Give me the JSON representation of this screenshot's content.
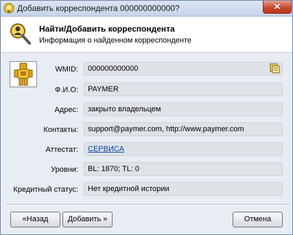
{
  "window": {
    "title": "Добавить корреспондента 000000000000?",
    "close_label": "✕",
    "title_icon": "webmoney-keeper-icon"
  },
  "header": {
    "title": "Найти/Добавить корреспондента",
    "subtitle": "Информация о найденном корреспонденте",
    "icon": "magnifier-person-icon"
  },
  "correspondent": {
    "avatar_icon": "robot-avatar-icon",
    "fields": {
      "wmid_label": "WMID:",
      "wmid_value": "000000000000",
      "fio_label": "Ф.И.О:",
      "fio_value": "PAYMER",
      "address_label": "Адрес:",
      "address_value": "закрыто владельцем",
      "contacts_label": "Контакты:",
      "contacts_value": "support@paymer.com, http://www.paymer.com",
      "attestat_label": "Аттестат:",
      "attestat_value": "СЕРВИСА",
      "levels_label": "Уровни:",
      "levels_value": "BL: 1870; TL: 0",
      "credit_label": "Кредитный статус:",
      "credit_value": "Нет кредитной истории"
    },
    "copy_icon": "copy-icon"
  },
  "buttons": {
    "back_label": "«Назад",
    "add_label": "Добавить »",
    "cancel_label": "Отмена"
  },
  "colors": {
    "titlebar": "#c7d4ea",
    "close_button": "#c9442a",
    "field_bg": "#dfe2e6",
    "link": "#0645ad"
  }
}
